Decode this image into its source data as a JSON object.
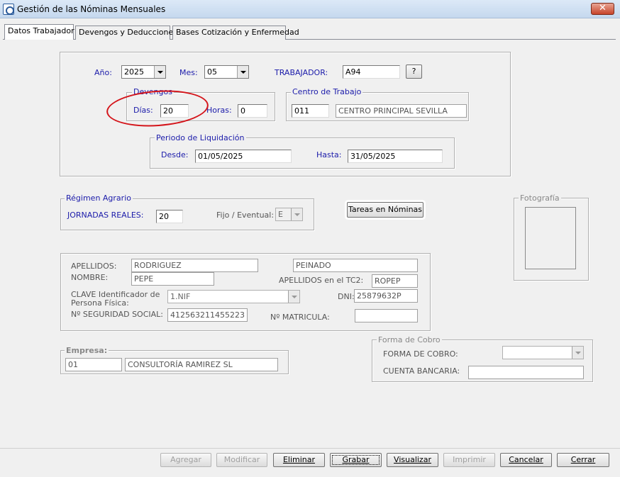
{
  "window": {
    "title": "Gestión de las Nóminas Mensuales",
    "close": "✕"
  },
  "tabs": [
    "Datos Trabajador",
    "Devengos y Deducciones",
    "Bases Cotización y Enfermedad"
  ],
  "period": {
    "year_label": "Año:",
    "year": "2025",
    "month_label": "Mes:",
    "month": "05",
    "worker_label": "TRABAJADOR:",
    "worker": "A94",
    "help": "?"
  },
  "devengos": {
    "legend": "Devengos",
    "dias_label": "Días:",
    "dias": "20",
    "horas_label": "Horas:",
    "horas": "0"
  },
  "centro": {
    "legend": "Centro de Trabajo",
    "code": "011",
    "name": "CENTRO PRINCIPAL SEVILLA"
  },
  "liquidacion": {
    "legend": "Periodo de Liquidación",
    "desde_label": "Desde:",
    "desde": "01/05/2025",
    "hasta_label": "Hasta:",
    "hasta": "31/05/2025"
  },
  "agrario": {
    "legend": "Régimen Agrario",
    "jornadas_label": "JORNADAS REALES:",
    "jornadas": "20",
    "fijo_label": "Fijo / Eventual:",
    "fijo": "E"
  },
  "tareas_button": "Tareas en Nóminas",
  "foto": {
    "legend": "Fotografía"
  },
  "personal": {
    "apellidos_label": "APELLIDOS:",
    "apellido1": "RODRIGUEZ",
    "apellido2": "PEINADO",
    "nombre_label": "NOMBRE:",
    "nombre": "PEPE",
    "tc2_label": "APELLIDOS en el TC2:",
    "tc2": "ROPEP",
    "clave_label1": "CLAVE Identificador de",
    "clave_label2": "Persona Física:",
    "clave": "1.NIF",
    "dni_label": "DNI:",
    "dni": "25879632P",
    "nss_label": "Nº SEGURIDAD SOCIAL:",
    "nss": "412563211455223",
    "matricula_label": "Nº MATRICULA:",
    "matricula": ""
  },
  "empresa": {
    "legend": "Empresa:",
    "code": "01",
    "name": "CONSULTORÍA RAMIREZ SL"
  },
  "cobro": {
    "legend": "Forma de Cobro",
    "forma_label": "FORMA DE COBRO:",
    "forma": "",
    "cuenta_label": "CUENTA BANCARIA:",
    "cuenta": ""
  },
  "buttons": {
    "agregar": "Agregar",
    "modificar": "Modificar",
    "eliminar": "Eliminar",
    "grabar": "Grabar",
    "visualizar": "Visualizar",
    "imprimir": "Imprimir",
    "cancelar": "Cancelar",
    "cerrar": "Cerrar"
  }
}
